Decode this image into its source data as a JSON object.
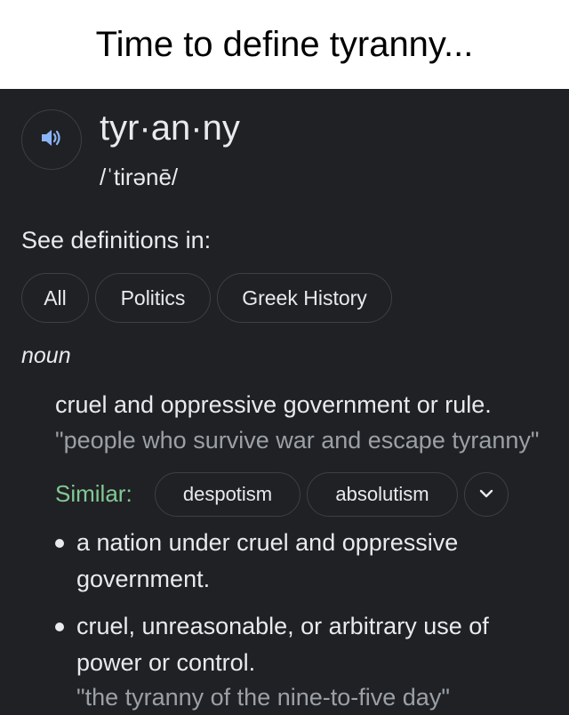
{
  "caption": "Time to define tyranny...",
  "entry": {
    "word": "tyr·an·ny",
    "phonetic": "/ˈtirənē/",
    "speaker_icon": "volume-icon"
  },
  "see_definitions": {
    "label": "See definitions in:",
    "chips": [
      "All",
      "Politics",
      "Greek History"
    ]
  },
  "part_of_speech": "noun",
  "definition_1": {
    "text": "cruel and oppressive government or rule.",
    "example": "\"people who survive war and escape tyranny\""
  },
  "similar": {
    "label": "Similar:",
    "chips": [
      "despotism",
      "absolutism"
    ],
    "expand_icon": "chevron-down-icon"
  },
  "sub_definitions": [
    {
      "text": "a nation under cruel and oppressive government."
    },
    {
      "text": "cruel, unreasonable, or arbitrary use of power or control.",
      "example": "\"the tyranny of the nine-to-five day\""
    }
  ],
  "colors": {
    "panel_bg": "#202124",
    "text": "#e8eaed",
    "secondary_text": "#9aa0a6",
    "similar_label": "#81c995",
    "chip_border": "#3c4043"
  }
}
